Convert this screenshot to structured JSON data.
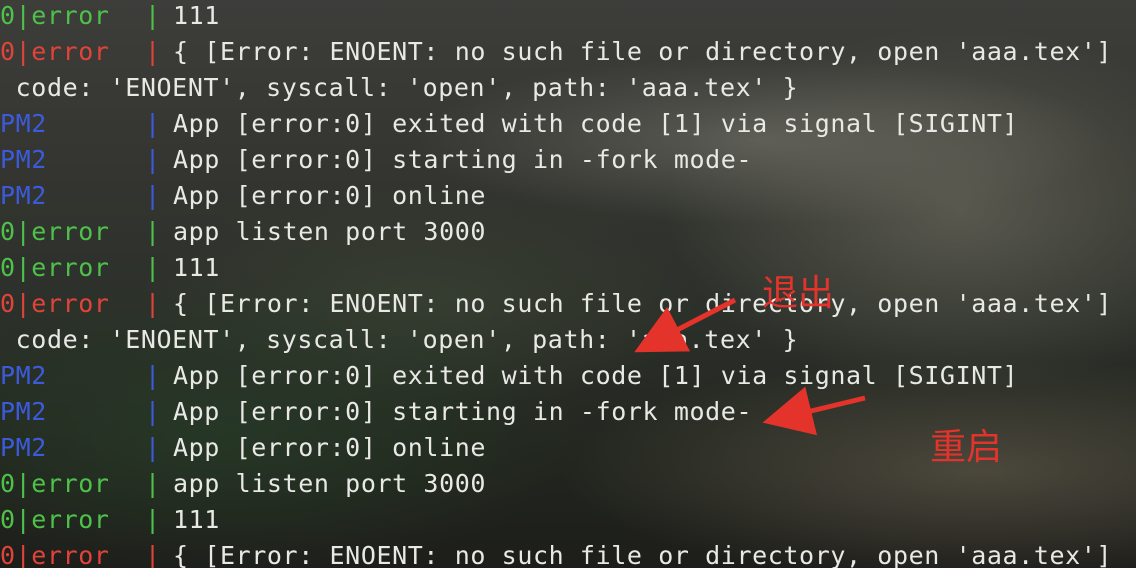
{
  "terminal": {
    "lines": [
      {
        "prefix": "0|error",
        "prefix_color": "green",
        "pipe_color": "green",
        "message": "111"
      },
      {
        "prefix": "0|error",
        "prefix_color": "red",
        "pipe_color": "red",
        "message": "{ [Error: ENOENT: no such file or directory, open 'aaa.tex']"
      },
      {
        "prefix": "",
        "prefix_color": "none",
        "pipe_color": "none",
        "message": " code: 'ENOENT', syscall: 'open', path: 'aaa.tex' }"
      },
      {
        "prefix": "PM2",
        "prefix_color": "blue",
        "pipe_color": "blue",
        "message": "App [error:0] exited with code [1] via signal [SIGINT]"
      },
      {
        "prefix": "PM2",
        "prefix_color": "blue",
        "pipe_color": "blue",
        "message": "App [error:0] starting in -fork mode-"
      },
      {
        "prefix": "PM2",
        "prefix_color": "blue",
        "pipe_color": "blue",
        "message": "App [error:0] online"
      },
      {
        "prefix": "0|error",
        "prefix_color": "green",
        "pipe_color": "green",
        "message": "app listen port 3000"
      },
      {
        "prefix": "0|error",
        "prefix_color": "green",
        "pipe_color": "green",
        "message": "111"
      },
      {
        "prefix": "0|error",
        "prefix_color": "red",
        "pipe_color": "red",
        "message": "{ [Error: ENOENT: no such file or directory, open 'aaa.tex']"
      },
      {
        "prefix": "",
        "prefix_color": "none",
        "pipe_color": "none",
        "message": " code: 'ENOENT', syscall: 'open', path: 'aaa.tex' }"
      },
      {
        "prefix": "PM2",
        "prefix_color": "blue",
        "pipe_color": "blue",
        "message": "App [error:0] exited with code [1] via signal [SIGINT]"
      },
      {
        "prefix": "PM2",
        "prefix_color": "blue",
        "pipe_color": "blue",
        "message": "App [error:0] starting in -fork mode-"
      },
      {
        "prefix": "PM2",
        "prefix_color": "blue",
        "pipe_color": "blue",
        "message": "App [error:0] online"
      },
      {
        "prefix": "0|error",
        "prefix_color": "green",
        "pipe_color": "green",
        "message": "app listen port 3000"
      },
      {
        "prefix": "0|error",
        "prefix_color": "green",
        "pipe_color": "green",
        "message": "111"
      },
      {
        "prefix": "0|error",
        "prefix_color": "red",
        "pipe_color": "red",
        "message": "{ [Error: ENOENT: no such file or directory, open 'aaa.tex']"
      }
    ]
  },
  "annotations": {
    "exit_label": "退出",
    "restart_label": "重启",
    "color": "#e3332a"
  },
  "colors": {
    "green": "#4ec14a",
    "red": "#e0433a",
    "blue": "#3b5bdb",
    "text": "#e8e8e4"
  }
}
